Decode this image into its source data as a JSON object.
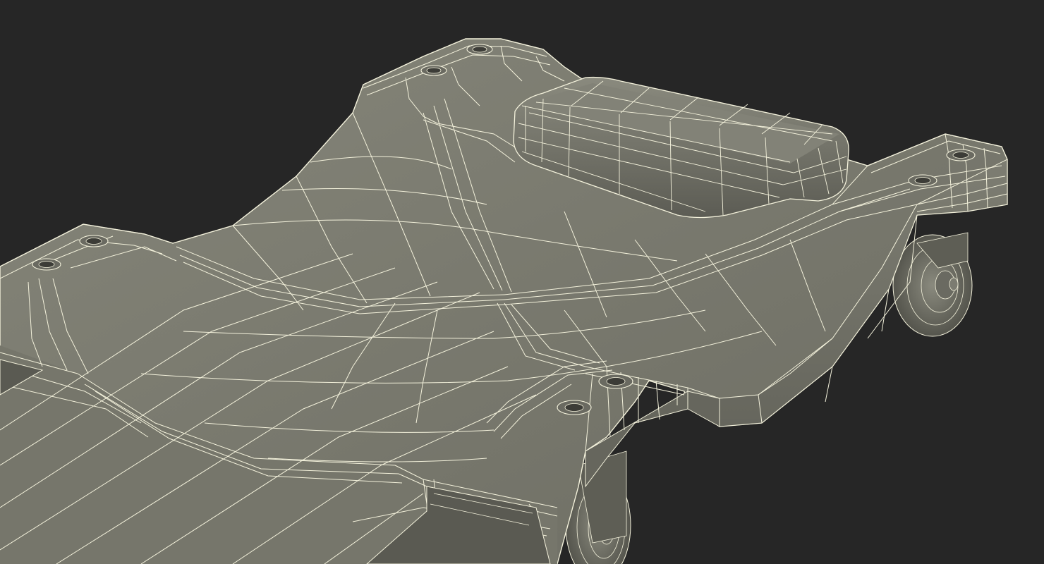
{
  "scene": {
    "background_color": "#262626",
    "surface_color": "#7a7a6e",
    "surface_dark_color": "#5e5e55",
    "wire_color": "#f4f2dc"
  }
}
